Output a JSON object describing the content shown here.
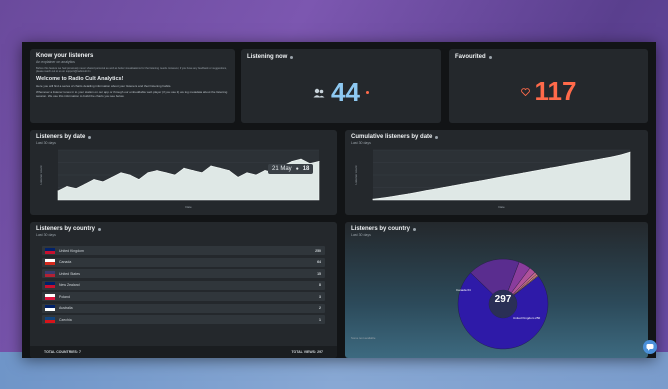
{
  "intro": {
    "title": "Know your listeners",
    "subtitle": "An explainer on analytics",
    "note": "Before this feature we had previously never shared personal as well as better visualisations for the listening needs. However, if you have any feedback or suggestions, please reach out to us on support@radiocult.fm",
    "heading": "Welcome to Radio Cult Analytics!",
    "p1": "Here you will find a series of charts detailing information about your listeners and their listening habits.",
    "p2": "Whenever a listener tunes in to your station on our app or through our embeddable web player (if you use it) we log metadata about the listening session. We use this information to build the charts you see below."
  },
  "listening_now": {
    "title": "Listening now",
    "value": "44",
    "icon": "headphones-icon"
  },
  "favourited": {
    "title": "Favourited",
    "value": "117",
    "icon": "heart-icon"
  },
  "listeners_by_date": {
    "title": "Listeners by date",
    "subtitle": "Last 30 days",
    "tooltip_date": "21 May",
    "tooltip_value": "18",
    "ylabel": "Listener count",
    "xlabel": "Date"
  },
  "cumulative": {
    "title": "Cumulative listeners by date",
    "subtitle": "Last 30 days",
    "ylabel": "Listener count",
    "xlabel": "Date"
  },
  "country_table": {
    "title": "Listeners by country",
    "subtitle": "Last 30 days",
    "rows": [
      {
        "name": "United Kingdom",
        "value": "250",
        "flag": "gb"
      },
      {
        "name": "Canada",
        "value": "64",
        "flag": "ca"
      },
      {
        "name": "United States",
        "value": "15",
        "flag": "us"
      },
      {
        "name": "New Zealand",
        "value": "8",
        "flag": "nz"
      },
      {
        "name": "Poland",
        "value": "3",
        "flag": "pl"
      },
      {
        "name": "Australia",
        "value": "2",
        "flag": "au"
      },
      {
        "name": "Czechia",
        "value": "1",
        "flag": "cz"
      }
    ],
    "footer_left": "TOTAL COUNTRIES: 7",
    "footer_right": "TOTAL VIEWS: 297"
  },
  "country_pie": {
    "title": "Listeners by country",
    "subtitle": "Last 30 days",
    "center_value": "297",
    "label_a": "United Kingdom 250",
    "label_b": "Canada 64",
    "footnote": "Some text available"
  },
  "chart_data": [
    {
      "type": "area",
      "title": "Listeners by date",
      "ylabel": "Listener count",
      "xlabel": "Date",
      "values": [
        4,
        6,
        5,
        7,
        9,
        8,
        10,
        12,
        11,
        9,
        12,
        13,
        12,
        11,
        14,
        13,
        12,
        15,
        14,
        13,
        10,
        12,
        11,
        13,
        12,
        15,
        17,
        18,
        16,
        17
      ],
      "ylim": [
        0,
        22
      ]
    },
    {
      "type": "area",
      "title": "Cumulative listeners by date",
      "ylabel": "Listener count",
      "xlabel": "Date",
      "values": [
        5,
        12,
        20,
        29,
        38,
        48,
        58,
        68,
        78,
        88,
        98,
        108,
        118,
        128,
        138,
        148,
        158,
        168,
        178,
        188,
        198,
        208,
        218,
        228,
        238,
        248,
        258,
        268,
        280,
        297
      ],
      "ylim": [
        0,
        310
      ]
    },
    {
      "type": "pie",
      "title": "Listeners by country",
      "categories": [
        "United Kingdom",
        "Canada",
        "United States",
        "New Zealand",
        "Poland",
        "Australia",
        "Czechia"
      ],
      "values": [
        250,
        64,
        15,
        8,
        3,
        2,
        1
      ],
      "colors": [
        "#2e1aa8",
        "#5a2d8f",
        "#8a3c9c",
        "#b0529a",
        "#c96d8c",
        "#d88a7c",
        "#e2a670"
      ]
    }
  ],
  "colors": {
    "accent_blue": "#8ec9f2",
    "accent_red": "#ff6a4a",
    "pie_blue": "#2e1aa8"
  }
}
